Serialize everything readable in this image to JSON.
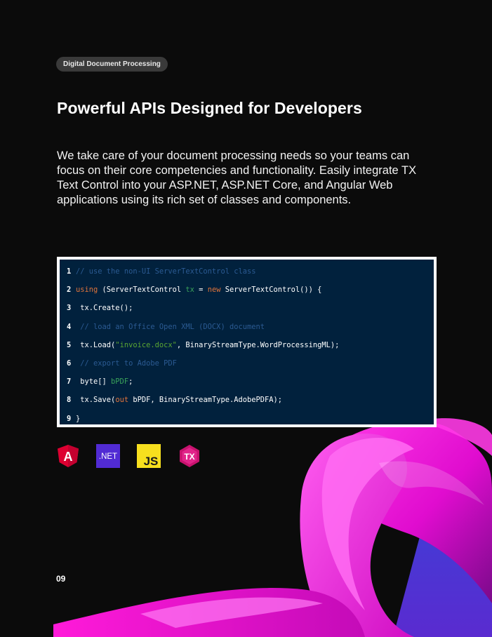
{
  "tag": "Digital Document Processing",
  "title": "Powerful APIs Designed for Developers",
  "lead_text": "We take care of your document processing needs so your teams can focus on their core competencies and functionality. Easily integrate TX Text Control into your ASP.NET, ASP.NET Core, and Angular Web applications using its rich set of classes and components.",
  "code": {
    "lines": [
      {
        "num": "1",
        "tokens": [
          {
            "t": "// use the non-UI ServerTextControl class",
            "c": "comment"
          }
        ]
      },
      {
        "num": "2",
        "tokens": [
          {
            "t": "using",
            "c": "keyword"
          },
          {
            "t": " (ServerTextControl ",
            "c": "plain"
          },
          {
            "t": "tx",
            "c": "green"
          },
          {
            "t": " = ",
            "c": "plain"
          },
          {
            "t": "new",
            "c": "keyword"
          },
          {
            "t": " ServerTextControl()) {",
            "c": "plain"
          }
        ]
      },
      {
        "num": "3",
        "tokens": [
          {
            "t": " tx.Create();",
            "c": "plain"
          }
        ]
      },
      {
        "num": "4",
        "tokens": [
          {
            "t": " // load an Office Open XML (DOCX) document",
            "c": "comment"
          }
        ]
      },
      {
        "num": "5",
        "tokens": [
          {
            "t": " tx.Load(",
            "c": "plain"
          },
          {
            "t": "\"invoice.docx\"",
            "c": "string"
          },
          {
            "t": ", BinaryStreamType.WordProcessingML);",
            "c": "plain"
          }
        ]
      },
      {
        "num": "6",
        "tokens": [
          {
            "t": " // export to Adobe PDF",
            "c": "comment"
          }
        ]
      },
      {
        "num": "7",
        "tokens": [
          {
            "t": " byte[] ",
            "c": "plain"
          },
          {
            "t": "bPDF",
            "c": "green"
          },
          {
            "t": ";",
            "c": "plain"
          }
        ]
      },
      {
        "num": "8",
        "tokens": [
          {
            "t": " tx.Save(",
            "c": "plain"
          },
          {
            "t": "out",
            "c": "keyword"
          },
          {
            "t": " bPDF, BinaryStreamType.AdobePDFA);",
            "c": "plain"
          }
        ]
      },
      {
        "num": "9",
        "tokens": [
          {
            "t": "}",
            "c": "plain"
          }
        ]
      }
    ]
  },
  "logos": [
    {
      "name": "angular-icon",
      "label": "A",
      "color": "#dd0031"
    },
    {
      "name": "dotnet-icon",
      "label": ".NET",
      "color": "#512bd4"
    },
    {
      "name": "javascript-icon",
      "label": "JS",
      "color": "#f7df1e"
    },
    {
      "name": "tx-icon",
      "label": "TX",
      "color": "#c8126e"
    }
  ],
  "page_number": "09",
  "colors": {
    "background": "#0b0b0b",
    "code_background": "#01213d",
    "accent_magenta": "#ff1ad9",
    "comment": "#2b5a92",
    "keyword": "#e0743b",
    "string": "#5aa632"
  }
}
